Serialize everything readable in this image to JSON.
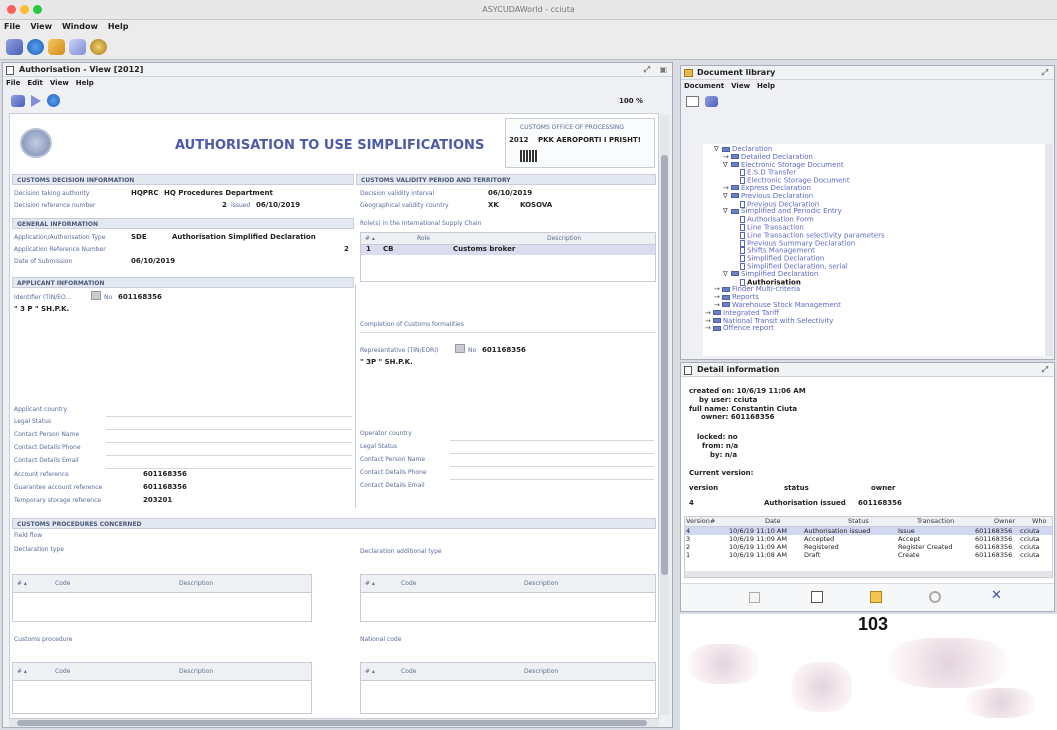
{
  "app": {
    "title": "ASYCUDAWorld - cciuta"
  },
  "menubar": {
    "items": [
      "File",
      "View",
      "Window",
      "Help"
    ]
  },
  "toolbar": {
    "icons": [
      "key-icon",
      "help-icon",
      "folder-icon",
      "mail-icon",
      "settings-icon"
    ]
  },
  "auth_window": {
    "title": "Authorisation - View [2012]",
    "menu": [
      "File",
      "Edit",
      "View",
      "Help"
    ],
    "zoom": "100 %",
    "doc_title": "AUTHORISATION TO USE SIMPLIFICATIONS",
    "office": {
      "label": "CUSTOMS OFFICE OF PROCESSING",
      "year": "2012",
      "name": "PKK AEROPORTI I PRISHT!"
    },
    "decision": {
      "header": "CUSTOMS DECISION INFORMATION",
      "authority_label": "Decision taking authority",
      "authority_code": "HQPRC",
      "authority_name": "HQ Procedures Department",
      "ref_label": "Decision reference number",
      "ref_value": "2",
      "status": "Issued",
      "date": "06/10/2019"
    },
    "validity": {
      "header": "CUSTOMS VALIDITY PERIOD AND TERRITORY",
      "interval_label": "Decision validity interval",
      "interval_value": "06/10/2019",
      "geo_label": "Geographical validity country",
      "geo_code": "XK",
      "geo_name": "KOSOVA"
    },
    "general": {
      "header": "GENERAL INFORMATION",
      "type_label": "Application/Authorisation Type",
      "type_code": "SDE",
      "type_name": "Authorisation Simplified Declaration",
      "appref_label": "Application Reference Number",
      "appref_value": "2",
      "date_label": "Date of Submission",
      "date_value": "06/10/2019"
    },
    "roles": {
      "header": "Role(s) in the International Supply Chain",
      "col_num": "# ▴",
      "col_role": "Role",
      "col_desc": "Description",
      "row_num": "1",
      "row_role": "CB",
      "row_desc": "Customs broker"
    },
    "applicant": {
      "header": "APPLICANT INFORMATION",
      "id_label": "Identifier (TIN/EO...",
      "id_flag": "No",
      "id_value": "601168356",
      "name": "\" 3 P \" SH.P.K.",
      "fields": [
        "Applicant country",
        "Legal Status",
        "Contact Person Name",
        "Contact Details Phone",
        "Contact Details Email",
        "Account reference",
        "Guarantee account reference",
        "Temporary storage reference"
      ],
      "account_ref": "601168356",
      "guarantee_ref": "601168356",
      "temp_storage_ref": "203201"
    },
    "completion": {
      "label": "Completion of Customs formalities",
      "rep_label": "Representative (TIN/EORI)",
      "rep_flag": "No",
      "rep_value": "601168356",
      "rep_name": "\" 3P \" SH.P.K.",
      "fields": [
        "Operator country",
        "Legal Status",
        "Contact Person Name",
        "Contact Details Phone",
        "Contact Details Email"
      ]
    },
    "procedures": {
      "header": "CUSTOMS PROCEDURES CONCERNED",
      "field_flow": "Field flow",
      "decl_type": "Declaration type",
      "decl_add_type": "Declaration additional type",
      "customs_proc": "Customs procedure",
      "national_code": "National code",
      "col_num": "# ▴",
      "col_code": "Code",
      "col_desc": "Description"
    }
  },
  "doclib": {
    "title": "Document library",
    "menu": [
      "Document",
      "View",
      "Help"
    ],
    "tree": [
      {
        "label": "Declaration",
        "depth": 1,
        "kind": "folder",
        "expander": "∇"
      },
      {
        "label": "Detailed Declaration",
        "depth": 2,
        "kind": "folder",
        "expander": "→"
      },
      {
        "label": "Electronic Storage Document",
        "depth": 2,
        "kind": "folder",
        "expander": "∇"
      },
      {
        "label": "E.S.D Transfer",
        "depth": 3,
        "kind": "doc",
        "expander": ""
      },
      {
        "label": "Electronic Storage Document",
        "depth": 3,
        "kind": "doc",
        "expander": ""
      },
      {
        "label": "Express Declaration",
        "depth": 2,
        "kind": "folder",
        "expander": "→"
      },
      {
        "label": "Previous Declaration",
        "depth": 2,
        "kind": "folder",
        "expander": "∇"
      },
      {
        "label": "Previous Declaration",
        "depth": 3,
        "kind": "doc",
        "expander": ""
      },
      {
        "label": "Simplified and Periodic Entry",
        "depth": 2,
        "kind": "folder",
        "expander": "∇"
      },
      {
        "label": "Authorisation Form",
        "depth": 3,
        "kind": "doc",
        "expander": ""
      },
      {
        "label": "Line Transaction",
        "depth": 3,
        "kind": "doc",
        "expander": ""
      },
      {
        "label": "Line Transaction selectivity parameters",
        "depth": 3,
        "kind": "doc",
        "expander": ""
      },
      {
        "label": "Previous Summary Declaration",
        "depth": 3,
        "kind": "doc",
        "expander": ""
      },
      {
        "label": "Shifts Management",
        "depth": 3,
        "kind": "doc",
        "expander": ""
      },
      {
        "label": "Simplified Declaration",
        "depth": 3,
        "kind": "doc",
        "expander": ""
      },
      {
        "label": "Simplified Declaration, serial",
        "depth": 3,
        "kind": "doc",
        "expander": ""
      },
      {
        "label": "Simplified Declaration",
        "depth": 2,
        "kind": "folder",
        "expander": "∇"
      },
      {
        "label": "Authorisation",
        "depth": 3,
        "kind": "doc",
        "expander": "",
        "selected": true
      },
      {
        "label": "Finder Multi-criteria",
        "depth": 1,
        "kind": "folder",
        "expander": "→"
      },
      {
        "label": "Reports",
        "depth": 1,
        "kind": "folder",
        "expander": "→"
      },
      {
        "label": "Warehouse Stock Management",
        "depth": 1,
        "kind": "folder",
        "expander": "→"
      },
      {
        "label": "Integrated Tariff",
        "depth": 0,
        "kind": "folder",
        "expander": "→"
      },
      {
        "label": "National Transit with Selectivity",
        "depth": 0,
        "kind": "folder",
        "expander": "→"
      },
      {
        "label": "Offence report",
        "depth": 0,
        "kind": "folder",
        "expander": "→"
      }
    ]
  },
  "detail": {
    "title": "Detail information",
    "created_on_label": "created on:",
    "created_on": "10/6/19 11:06 AM",
    "by_user_label": "by user:",
    "by_user": "cciuta",
    "full_name_label": "full name:",
    "full_name": "Constantin Ciuta",
    "owner_label": "owner:",
    "owner": "601168356",
    "locked_label": "locked:",
    "locked": "no",
    "from_label": "from:",
    "from": "n/a",
    "by_label": "by:",
    "by": "n/a",
    "current_version_label": "Current version:",
    "cv_headers": [
      "version",
      "status",
      "owner"
    ],
    "cv_version": "4",
    "cv_status": "Authorisation issued",
    "cv_owner": "601168356",
    "history_headers": [
      "Version#",
      "Date",
      "Status",
      "Transaction",
      "Owner",
      "Who"
    ],
    "history": [
      {
        "v": "4",
        "date": "10/6/19 11:10 AM",
        "status": "Authorisation issued",
        "transaction": "Issue",
        "owner": "601168356",
        "who": "cciuta"
      },
      {
        "v": "3",
        "date": "10/6/19 11:09 AM",
        "status": "Accepted",
        "transaction": "Accept",
        "owner": "601168356",
        "who": "cciuta"
      },
      {
        "v": "2",
        "date": "10/6/19 11:09 AM",
        "status": "Registered",
        "transaction": "Register Created",
        "owner": "601168356",
        "who": "cciuta"
      },
      {
        "v": "1",
        "date": "10/6/19 11:08 AM",
        "status": "Draft",
        "transaction": "Create",
        "owner": "601168356",
        "who": "cciuta"
      }
    ]
  },
  "page_number": "103"
}
